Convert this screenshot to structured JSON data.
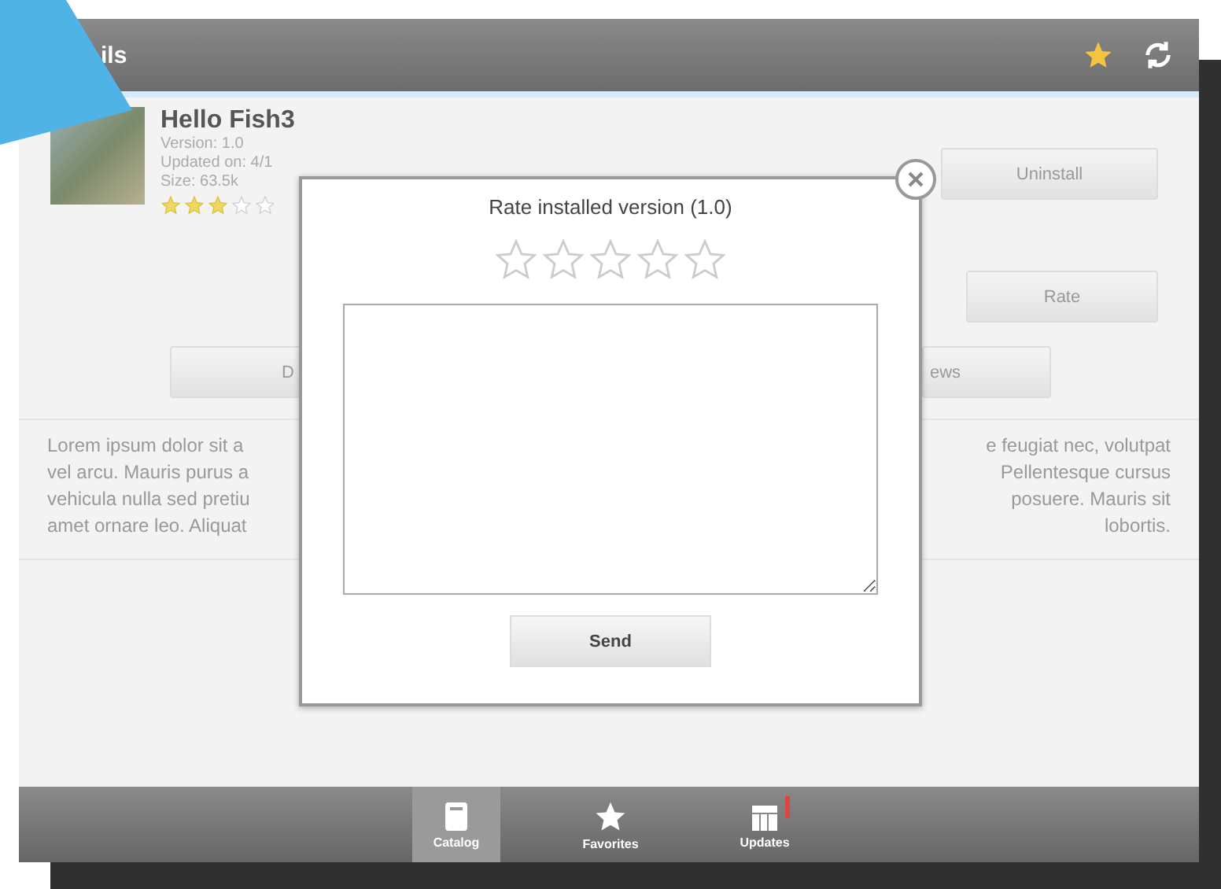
{
  "header": {
    "title": "ils"
  },
  "app": {
    "name": "Hello Fish3",
    "version": "Version: 1.0",
    "updated": "Updated on: 4/1",
    "size": "Size: 63.5k",
    "stars": 3
  },
  "side_buttons": [
    "Uninstall",
    "Rate"
  ],
  "row_buttons": [
    "D",
    "ews"
  ],
  "description": {
    "left": [
      "Lorem ipsum dolor sit a",
      "vel arcu. Mauris purus a",
      "vehicula nulla sed pretiu",
      "amet ornare leo. Aliquat"
    ],
    "right": [
      "e feugiat nec, volutpat",
      "Pellentesque cursus",
      "posuere. Mauris sit",
      "lobortis."
    ]
  },
  "dialog": {
    "title": "Rate installed version (1.0)",
    "stars": 0,
    "send": "Send"
  },
  "tabs": [
    {
      "label": "Catalog",
      "selected": true,
      "kind": "catalog",
      "badge": false
    },
    {
      "label": "Favorites",
      "selected": false,
      "kind": "favorites",
      "badge": false
    },
    {
      "label": "Updates",
      "selected": false,
      "kind": "updates",
      "badge": true
    }
  ]
}
